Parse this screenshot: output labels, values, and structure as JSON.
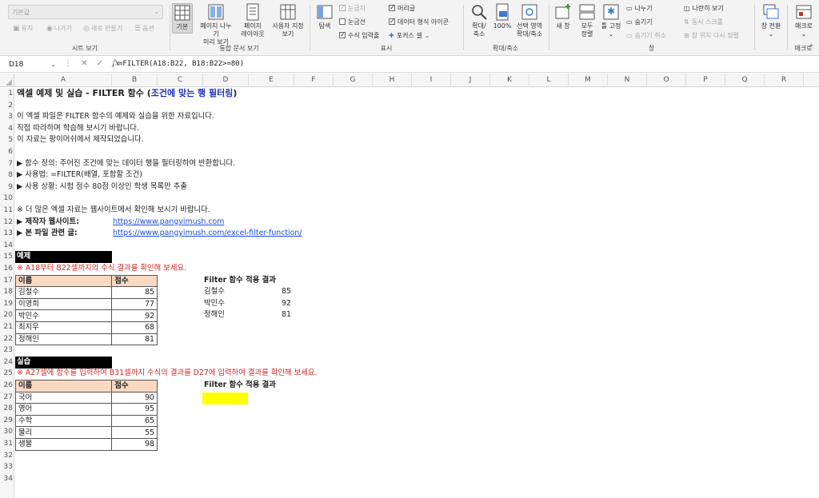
{
  "ribbon": {
    "sheet_view": {
      "dropdown": "기본값",
      "keep": "유지",
      "exit": "나가기",
      "new": "새로 만들기",
      "options": "옵션",
      "label": "시트 보기"
    },
    "workbook_views": {
      "normal": "기본",
      "page_break_1": "페이지 나누기",
      "page_break_2": "미리 보기",
      "page_layout_1": "페이지",
      "page_layout_2": "레이아웃",
      "custom_1": "사용자 지정",
      "custom_2": "보기",
      "label": "통합 문서 보기"
    },
    "show": {
      "navigation": "탐색",
      "ruler": "눈금자",
      "gridlines": "눈금선",
      "formula_bar": "수식 입력줄",
      "headings": "머리글",
      "data_format_icons": "데이터 형식 아이콘",
      "focus_cell": "포커스 셀",
      "label": "표시"
    },
    "zoom": {
      "zoom_1": "확대/",
      "zoom_2": "축소",
      "hundred": "100%",
      "selection_1": "선택 영역",
      "selection_2": "확대/축소",
      "label": "확대/축소"
    },
    "window": {
      "new_window": "새 창",
      "arrange_1": "모두",
      "arrange_2": "정렬",
      "freeze": "틀 고정",
      "split": "나누기",
      "hide": "숨기기",
      "unhide": "숨기기 취소",
      "side_by_side": "나란히 보기",
      "sync_scroll": "동시 스크롤",
      "reset_position": "창 위치 다시 정렬",
      "switch_1": "창 전환",
      "label": "창"
    },
    "macros": {
      "macros": "매크로",
      "label": "매크로"
    }
  },
  "formula_bar": {
    "name_box": "D18",
    "formula": "=FILTER(A18:B22, B18:B22>=80)",
    "fx": "fx"
  },
  "columns": [
    "A",
    "B",
    "C",
    "D",
    "E",
    "F",
    "G",
    "H",
    "I",
    "J",
    "K",
    "L",
    "M",
    "N",
    "O",
    "P",
    "Q",
    "R",
    "S"
  ],
  "rows": [
    "1",
    "2",
    "3",
    "4",
    "5",
    "6",
    "7",
    "8",
    "9",
    "10",
    "11",
    "12",
    "13",
    "14",
    "15",
    "16",
    "17",
    "18",
    "19",
    "20",
    "21",
    "22",
    "23",
    "24",
    "25",
    "26",
    "27",
    "28",
    "29",
    "30",
    "31",
    "32",
    "33",
    "34"
  ],
  "sheet": {
    "title_main": "엑셀 예제 및 실습 - FILTER 함수 (",
    "title_blue": "조건에 맞는 행 필터링",
    "title_end": ")",
    "intro1": "이 엑셀 파일은 FILTER 함수의 예제와 실습을 위한 자료입니다.",
    "intro2": "직접 따라하며 학습해 보시기 바랍니다.",
    "intro3": "이 자료는 팡이머쉬에서 제작되었습니다.",
    "def": "▶ 함수 정의: 주어진 조건에 맞는 데이터 행을 필터링하여 반환합니다.",
    "usage": "▶ 사용법: =FILTER(배열, 포함할 조건)",
    "situation": "▶ 사용 상황: 시험 점수 80점 이상인 학생 목록만 추출",
    "more": "※ 더 많은 엑셀 자료는 웹사이트에서 확인해 보시기 바랍니다.",
    "site_label": "▶ 제작자 웹사이트:",
    "site_url": "https://www.pangyimush.com",
    "file_label": "▶ 본 파일 관련 글:",
    "file_url": "https://www.pangyimush.com/excel-filter-function/",
    "example_header": "예제",
    "example_note": "※ A18부터 B22셀까지의 수식 결과를 확인해 보세요.",
    "practice_header": "실습",
    "practice_note": "※ A27셀에 함수를 입력하여 B31셀까지 수식의 결과를 D27에 입력하여 결과를 확인해 보세요.",
    "result_title": "Filter 함수 적용 결과",
    "practice_result_title": "Filter 함수 적용 결과"
  },
  "example_table": {
    "headers": [
      "이름",
      "점수"
    ],
    "rows": [
      [
        "김철수",
        "85"
      ],
      [
        "이영희",
        "77"
      ],
      [
        "박민수",
        "92"
      ],
      [
        "최지우",
        "68"
      ],
      [
        "정해인",
        "81"
      ]
    ]
  },
  "example_result": [
    [
      "김철수",
      "85"
    ],
    [
      "박민수",
      "92"
    ],
    [
      "정해인",
      "81"
    ]
  ],
  "practice_table": {
    "headers": [
      "이름",
      "점수"
    ],
    "rows": [
      [
        "국어",
        "90"
      ],
      [
        "영어",
        "95"
      ],
      [
        "수학",
        "65"
      ],
      [
        "물리",
        "55"
      ],
      [
        "생물",
        "98"
      ]
    ]
  }
}
